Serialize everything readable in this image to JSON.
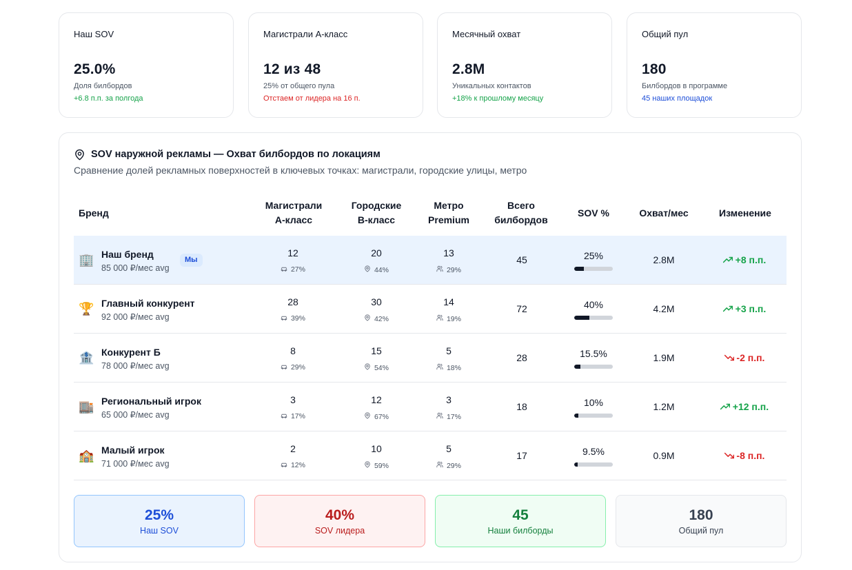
{
  "kpis": [
    {
      "label": "Наш SOV",
      "value": "25.0%",
      "sub": "Доля билбордов",
      "note": "+6.8 п.п. за полгода",
      "note_color": "#16a34a"
    },
    {
      "label": "Магистрали А-класс",
      "value": "12 из 48",
      "sub": "25% от общего пула",
      "note": "Отстаем от лидера на 16 п.",
      "note_color": "#dc2626"
    },
    {
      "label": "Месячный охват",
      "value": "2.8M",
      "sub": "Уникальных контактов",
      "note": "+18% к прошлому месяцу",
      "note_color": "#16a34a"
    },
    {
      "label": "Общий пул",
      "value": "180",
      "sub": "Билбордов в программе",
      "note": "45 наших площадок",
      "note_color": "#1d4ed8"
    }
  ],
  "panel": {
    "icon": "location-pin-icon",
    "title": "SOV наружной рекламы — Охват билбордов по локациям",
    "subtitle": "Сравнение долей рекламных поверхностей в ключевых точках: магистрали, городские улицы, метро"
  },
  "table": {
    "headers": {
      "brand": "Бренд",
      "highways_1": "Магистрали",
      "highways_2": "А-класс",
      "city_1": "Городские",
      "city_2": "B-класс",
      "metro_1": "Метро",
      "metro_2": "Premium",
      "total_1": "Всего",
      "total_2": "билбордов",
      "sov": "SOV %",
      "reach": "Охват/мес",
      "change": "Изменение"
    },
    "rows": [
      {
        "icon": "🏢",
        "icon_name": "office-building-icon",
        "name": "Наш бренд",
        "price": "85 000 ₽/мес avg",
        "badge": "Мы",
        "highways": "12",
        "highways_pct": "27%",
        "city": "20",
        "city_pct": "44%",
        "metro": "13",
        "metro_pct": "29%",
        "total": "45",
        "sov": "25%",
        "sov_fraction": 0.25,
        "reach": "2.8M",
        "change": "+8 п.п.",
        "trend": "up"
      },
      {
        "icon": "🏆",
        "icon_name": "trophy-icon",
        "name": "Главный конкурент",
        "price": "92 000 ₽/мес avg",
        "badge": "",
        "highways": "28",
        "highways_pct": "39%",
        "city": "30",
        "city_pct": "42%",
        "metro": "14",
        "metro_pct": "19%",
        "total": "72",
        "sov": "40%",
        "sov_fraction": 0.4,
        "reach": "4.2M",
        "change": "+3 п.п.",
        "trend": "up"
      },
      {
        "icon": "🏦",
        "icon_name": "bank-building-icon",
        "name": "Конкурент Б",
        "price": "78 000 ₽/мес avg",
        "badge": "",
        "highways": "8",
        "highways_pct": "29%",
        "city": "15",
        "city_pct": "54%",
        "metro": "5",
        "metro_pct": "18%",
        "total": "28",
        "sov": "15.5%",
        "sov_fraction": 0.155,
        "reach": "1.9M",
        "change": "-2 п.п.",
        "trend": "down"
      },
      {
        "icon": "🏬",
        "icon_name": "department-store-icon",
        "name": "Региональный игрок",
        "price": "65 000 ₽/мес avg",
        "badge": "",
        "highways": "3",
        "highways_pct": "17%",
        "city": "12",
        "city_pct": "67%",
        "metro": "3",
        "metro_pct": "17%",
        "total": "18",
        "sov": "10%",
        "sov_fraction": 0.1,
        "reach": "1.2M",
        "change": "+12 п.п.",
        "trend": "up"
      },
      {
        "icon": "🏫",
        "icon_name": "small-building-icon",
        "name": "Малый игрок",
        "price": "71 000 ₽/мес avg",
        "badge": "",
        "highways": "2",
        "highways_pct": "12%",
        "city": "10",
        "city_pct": "59%",
        "metro": "5",
        "metro_pct": "29%",
        "total": "17",
        "sov": "9.5%",
        "sov_fraction": 0.095,
        "reach": "0.9M",
        "change": "-8 п.п.",
        "trend": "down"
      }
    ]
  },
  "summary": [
    {
      "value": "25%",
      "label": "Наш SOV",
      "tone": "blue"
    },
    {
      "value": "40%",
      "label": "SOV лидера",
      "tone": "red"
    },
    {
      "value": "45",
      "label": "Наши билборды",
      "tone": "green"
    },
    {
      "value": "180",
      "label": "Общий пул",
      "tone": "gray"
    }
  ],
  "colors": {
    "up": "#16a34a",
    "down": "#dc2626",
    "bar_fill": "#111827",
    "bar_track": "#d1d5db",
    "highlight_row": "#eaf3fe"
  }
}
